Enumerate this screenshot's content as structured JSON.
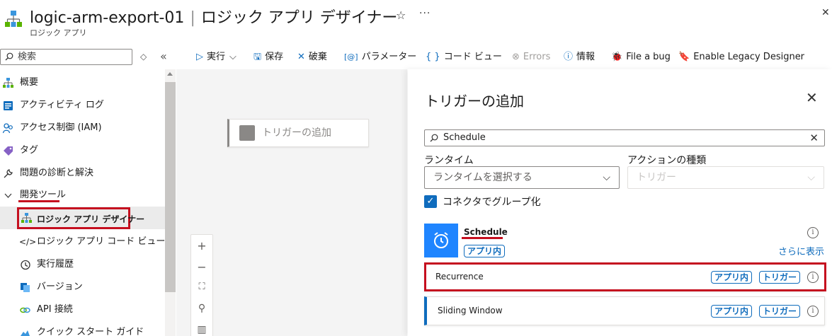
{
  "header": {
    "title": "logic-arm-export-01",
    "title_suffix": "ロジック アプリ デザイナー",
    "subtitle": "ロジック アプリ",
    "star_icon": "☆",
    "more_icon": "···"
  },
  "sidebar": {
    "search_placeholder": "検索",
    "items": [
      {
        "label": "概要",
        "icon": "overview-icon"
      },
      {
        "label": "アクティビティ ログ",
        "icon": "activity-log-icon"
      },
      {
        "label": "アクセス制御 (IAM)",
        "icon": "iam-icon"
      },
      {
        "label": "タグ",
        "icon": "tag-icon"
      },
      {
        "label": "問題の診断と解決",
        "icon": "wrench-icon"
      },
      {
        "label": "開発ツール",
        "icon": "chevron-down-icon"
      },
      {
        "label": "ロジック アプリ デザイナー",
        "icon": "designer-icon"
      },
      {
        "label": "ロジック アプリ コード ビュー",
        "icon": "code-icon"
      },
      {
        "label": "実行履歴",
        "icon": "history-icon"
      },
      {
        "label": "バージョン",
        "icon": "versions-icon"
      },
      {
        "label": "API 接続",
        "icon": "api-connection-icon"
      },
      {
        "label": "クイック スタート ガイド",
        "icon": "quickstart-icon"
      }
    ]
  },
  "toolbar": {
    "run": "実行",
    "save": "保存",
    "discard": "破棄",
    "parameters": "パラメーター",
    "code_view": "コード ビュー",
    "errors": "Errors",
    "info": "情報",
    "file_bug": "File a bug",
    "legacy": "Enable Legacy Designer"
  },
  "canvas": {
    "trigger_card": "トリガーの追加",
    "zoom": [
      "+",
      "−",
      "⛶",
      "⚲",
      "▥"
    ]
  },
  "panel": {
    "title": "トリガーの追加",
    "search_value": "Schedule",
    "runtime_label": "ランタイム",
    "runtime_placeholder": "ランタイムを選択する",
    "action_type_label": "アクションの種類",
    "action_type_placeholder": "トリガー",
    "group_by_connector": "コネクタでグループ化",
    "connector": {
      "name": "Schedule",
      "badge": "アプリ内",
      "show_more": "さらに表示"
    },
    "operations": [
      {
        "name": "Recurrence",
        "badge1": "アプリ内",
        "badge2": "トリガー"
      },
      {
        "name": "Sliding Window",
        "badge1": "アプリ内",
        "badge2": "トリガー"
      }
    ]
  },
  "colors": {
    "accent": "#0f6cbd",
    "highlight_red": "#c50f1f",
    "connector_blue": "#1f85ff"
  }
}
